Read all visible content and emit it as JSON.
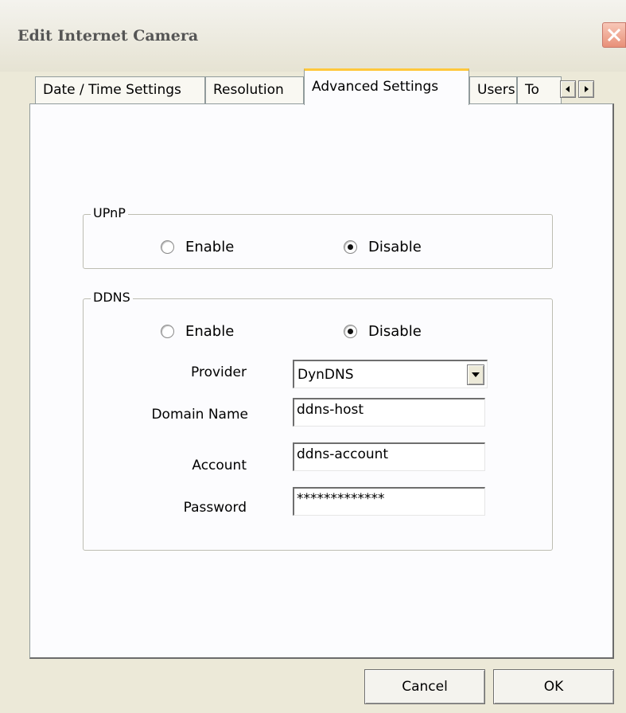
{
  "window": {
    "title": "Edit Internet Camera"
  },
  "tabs": [
    {
      "label": "Date / Time Settings"
    },
    {
      "label": "Resolution"
    },
    {
      "label": "Advanced Settings"
    },
    {
      "label": "Users"
    },
    {
      "label": "To"
    }
  ],
  "active_tab": "Advanced Settings",
  "upnp": {
    "legend": "UPnP",
    "enable_label": "Enable",
    "disable_label": "Disable",
    "selected": "Disable"
  },
  "ddns": {
    "legend": "DDNS",
    "enable_label": "Enable",
    "disable_label": "Disable",
    "selected": "Disable",
    "provider_label": "Provider",
    "provider_value": "DynDNS",
    "domain_label": "Domain Name",
    "domain_value": "ddns-host",
    "account_label": "Account",
    "account_value": "ddns-account",
    "password_label": "Password",
    "password_value": "*************"
  },
  "buttons": {
    "cancel": "Cancel",
    "ok": "OK"
  },
  "colors": {
    "dialog_bg": "#ECE9D8",
    "tab_highlight": "#FFC83C",
    "close_button": "#E89078"
  },
  "icons": {
    "close": "close-icon",
    "scroll_left": "arrow-left-icon",
    "scroll_right": "arrow-right-icon",
    "dropdown": "chevron-down-icon"
  }
}
